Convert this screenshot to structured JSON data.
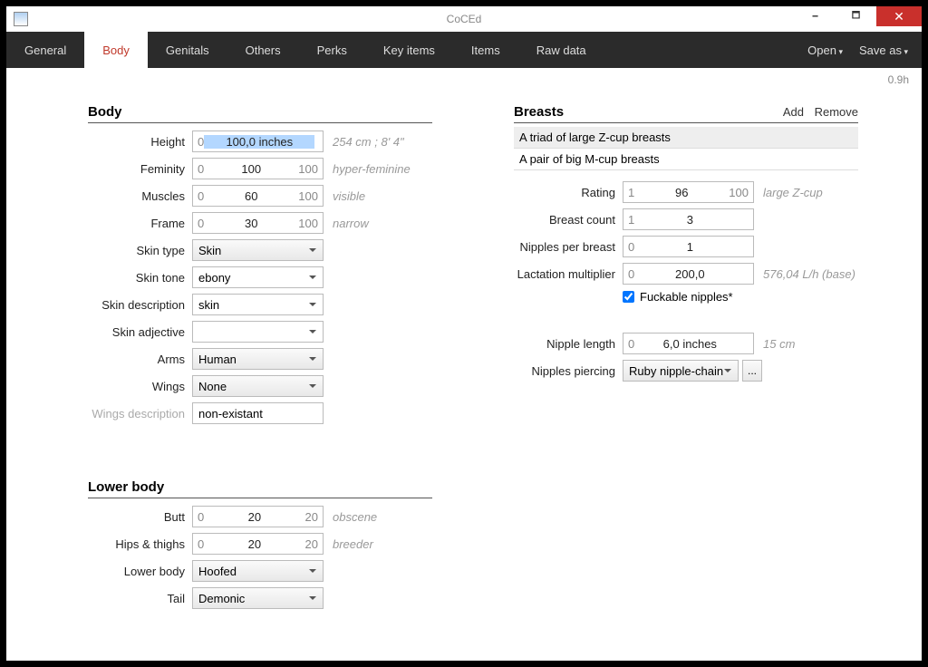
{
  "window": {
    "title": "CoCEd"
  },
  "winControls": {
    "min": "🗕",
    "max": "🗖",
    "close": "✕"
  },
  "tabs": [
    "General",
    "Body",
    "Genitals",
    "Others",
    "Perks",
    "Key items",
    "Items",
    "Raw data"
  ],
  "activeTab": "Body",
  "menuRight": {
    "open": "Open",
    "saveAs": "Save as"
  },
  "status": "0.9h",
  "body": {
    "title": "Body",
    "height": {
      "label": "Height",
      "min": "0",
      "val": "100,0 inches",
      "hint": "254 cm ; 8' 4\""
    },
    "feminity": {
      "label": "Feminity",
      "min": "0",
      "val": "100",
      "max": "100",
      "hint": "hyper-feminine"
    },
    "muscles": {
      "label": "Muscles",
      "min": "0",
      "val": "60",
      "max": "100",
      "hint": "visible"
    },
    "frame": {
      "label": "Frame",
      "min": "0",
      "val": "30",
      "max": "100",
      "hint": "narrow"
    },
    "skinType": {
      "label": "Skin type",
      "val": "Skin"
    },
    "skinTone": {
      "label": "Skin tone",
      "val": "ebony"
    },
    "skinDesc": {
      "label": "Skin description",
      "val": "skin"
    },
    "skinAdj": {
      "label": "Skin adjective",
      "val": ""
    },
    "arms": {
      "label": "Arms",
      "val": "Human"
    },
    "wings": {
      "label": "Wings",
      "val": "None"
    },
    "wingsDesc": {
      "label": "Wings description",
      "val": "non-existant"
    }
  },
  "lower": {
    "title": "Lower body",
    "butt": {
      "label": "Butt",
      "min": "0",
      "val": "20",
      "max": "20",
      "hint": "obscene"
    },
    "hips": {
      "label": "Hips & thighs",
      "min": "0",
      "val": "20",
      "max": "20",
      "hint": "breeder"
    },
    "lowerBody": {
      "label": "Lower body",
      "val": "Hoofed"
    },
    "tail": {
      "label": "Tail",
      "val": "Demonic"
    }
  },
  "breasts": {
    "title": "Breasts",
    "add": "Add",
    "remove": "Remove",
    "rows": [
      "A triad of large Z-cup breasts",
      "A pair of big M-cup breasts"
    ],
    "rating": {
      "label": "Rating",
      "min": "1",
      "val": "96",
      "max": "100",
      "hint": "large Z-cup"
    },
    "count": {
      "label": "Breast count",
      "min": "1",
      "val": "3"
    },
    "npb": {
      "label": "Nipples per breast",
      "min": "0",
      "val": "1"
    },
    "lact": {
      "label": "Lactation multiplier",
      "min": "0",
      "val": "200,0",
      "hint": "576,04 L/h (base)"
    },
    "fuckable": {
      "label": "Fuckable nipples*",
      "checked": true
    },
    "nipLen": {
      "label": "Nipple length",
      "min": "0",
      "val": "6,0 inches",
      "hint": "15 cm"
    },
    "piercing": {
      "label": "Nipples piercing",
      "val": "Ruby nipple-chain",
      "dots": "..."
    }
  }
}
